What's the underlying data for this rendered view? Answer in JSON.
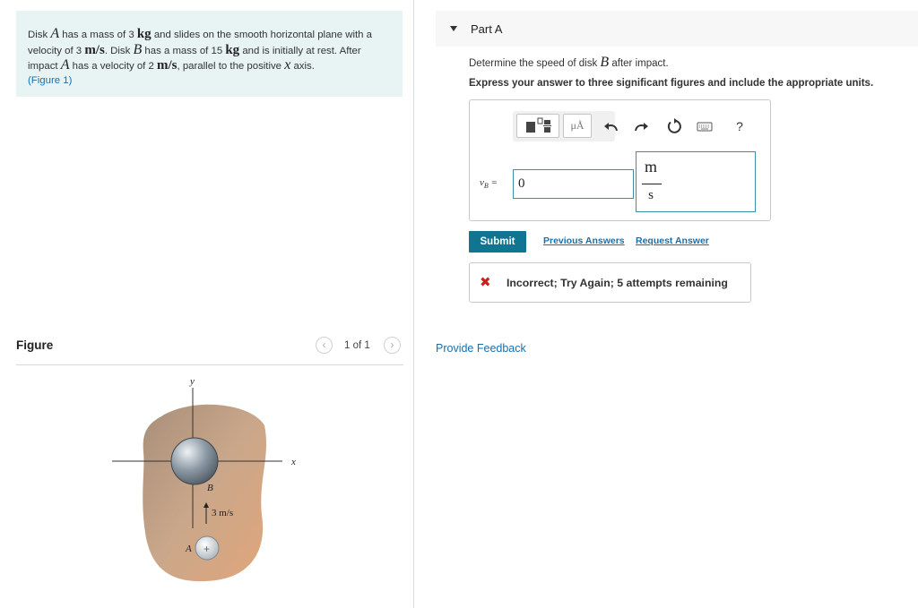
{
  "problem": {
    "t1": "Disk ",
    "var_a": "A",
    "t2": " has a mass of 3 ",
    "unit_kg": "kg",
    "t3": " and slides on the smooth horizontal plane with a velocity of 3 ",
    "unit_ms": "m/s",
    "t4": ". Disk ",
    "var_b": "B",
    "t5": " has a mass of 15 ",
    "unit_kg2": "kg",
    "t6": " and is initially at rest. After impact ",
    "var_a2": "A",
    "t7": " has a velocity of 2 ",
    "unit_ms2": "m/s",
    "t8": ", parallel to the positive ",
    "var_x": "x",
    "t9": " axis.",
    "figure_link": "(Figure 1)"
  },
  "figure": {
    "title": "Figure",
    "counter": "1 of 1",
    "labels": {
      "y": "y",
      "x": "x",
      "b": "B",
      "a": "A",
      "velocity": "3 m/s",
      "plus": "+"
    }
  },
  "part": {
    "title": "Part A",
    "question_prefix": "Determine the speed of disk ",
    "question_var": "B",
    "question_suffix": " after impact.",
    "instruction": "Express your answer to three significant figures and include the appropriate units."
  },
  "answer": {
    "label_main": "v",
    "label_sub": "B",
    "label_eq": " =",
    "value": "0",
    "unit_num": "m",
    "unit_den": "s",
    "units_button": "μÅ"
  },
  "toolbar": {
    "icons": [
      "templates-icon",
      "units-icon",
      "undo-icon",
      "redo-icon",
      "reset-icon",
      "keyboard-icon",
      "help-icon"
    ],
    "help": "?"
  },
  "actions": {
    "submit": "Submit",
    "previous": "Previous Answers",
    "request": "Request Answer"
  },
  "feedback": {
    "text": "Incorrect; Try Again; 5 attempts remaining",
    "color": "#cc1f1f"
  },
  "provide_feedback": "Provide Feedback"
}
